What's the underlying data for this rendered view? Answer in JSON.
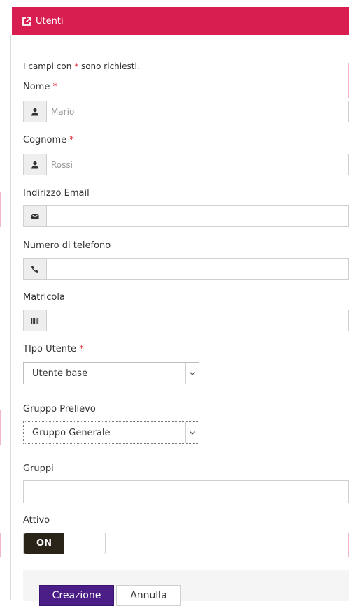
{
  "header": {
    "title": "Utenti",
    "icon": "external-link-icon",
    "color": "#d81e50"
  },
  "form": {
    "note_prefix": "I campi con ",
    "note_star": "*",
    "note_suffix": " sono richiesti.",
    "nome": {
      "label": "Nome",
      "required": "*",
      "placeholder": "Mario",
      "icon": "user-icon"
    },
    "cognome": {
      "label": "Cognome",
      "required": "*",
      "placeholder": "Rossi",
      "icon": "user-icon"
    },
    "email": {
      "label": "Indirizzo Email",
      "placeholder": "",
      "icon": "envelope-icon"
    },
    "telefono": {
      "label": "Numero di telefono",
      "placeholder": "",
      "icon": "phone-icon"
    },
    "matricola": {
      "label": "Matricola",
      "placeholder": "",
      "icon": "barcode-icon"
    },
    "tipo_utente": {
      "label": "TIpo Utente",
      "required": "*",
      "selected": "Utente base"
    },
    "gruppo_prelievo": {
      "label": "Gruppo Prelievo",
      "selected": "Gruppo Generale"
    },
    "gruppi": {
      "label": "Gruppi",
      "value": ""
    },
    "attivo": {
      "label": "Attivo",
      "state": "ON"
    }
  },
  "actions": {
    "create_label": "Creazione",
    "cancel_label": "Annulla",
    "primary_color": "#4a1e86"
  }
}
